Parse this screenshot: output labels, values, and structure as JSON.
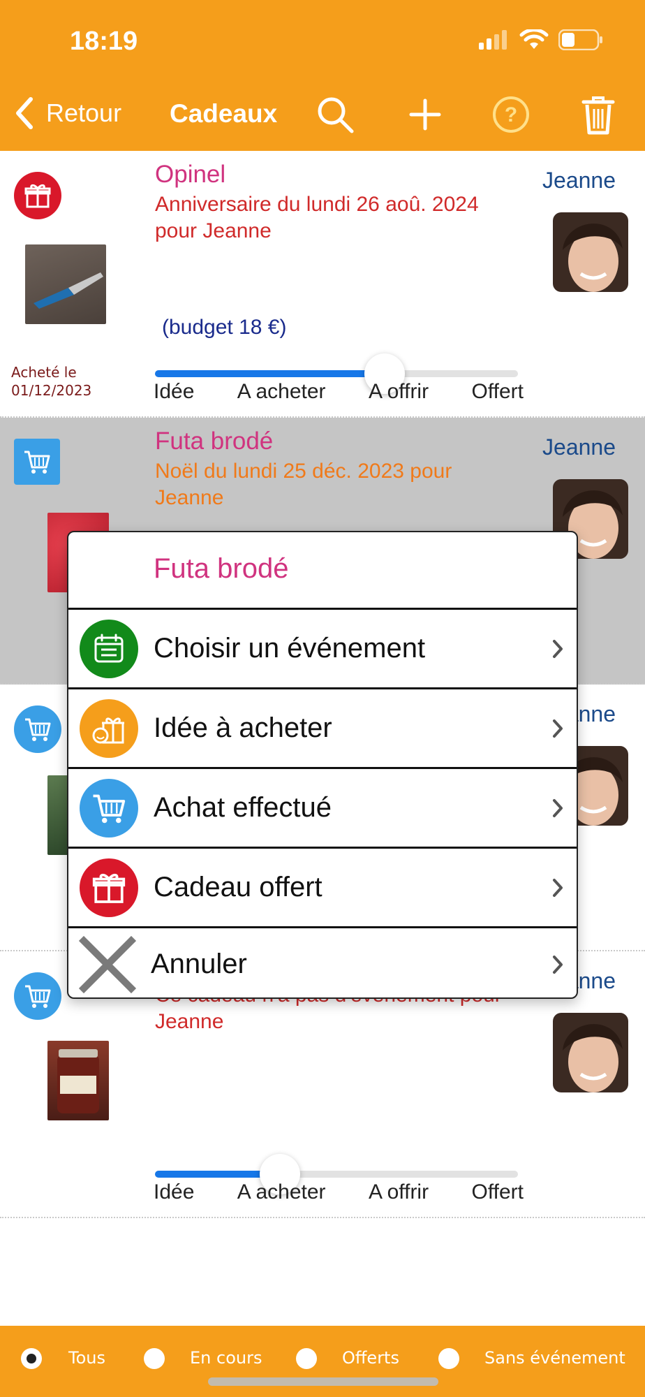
{
  "status_bar": {
    "time": "18:19"
  },
  "nav": {
    "back_label": "Retour",
    "title": "Cadeaux",
    "icons": [
      "search-icon",
      "add-icon",
      "help-icon",
      "trash-icon"
    ]
  },
  "gifts": [
    {
      "title": "Opinel",
      "subtitle": "Anniversaire du lundi 26 aoû. 2024 pour Jeanne",
      "person": "Jeanne",
      "budget": "(budget 18 €)",
      "bought_label": "Acheté le",
      "bought_date": "01/12/2023",
      "status_icon": "gift-icon",
      "progress": 0.65
    },
    {
      "title": "Futa brodé",
      "subtitle": "Noël du lundi 25 déc. 2023 pour Jeanne",
      "person": "Jeanne",
      "status_icon": "cart-icon"
    },
    {
      "person": "Jeanne",
      "status_icon": "cart-icon"
    },
    {
      "subtitle": "Ce cadeau n'a pas d'événement pour Jeanne",
      "person": "Jeanne",
      "status_icon": "cart-icon",
      "progress": 0.35
    }
  ],
  "slider_labels": [
    "Idée",
    "A acheter",
    "A offrir",
    "Offert"
  ],
  "menu": {
    "title": "Futa brodé",
    "items": [
      {
        "label": "Choisir un événement",
        "icon": "calendar-icon",
        "color": "#128a1a"
      },
      {
        "label": "Idée à acheter",
        "icon": "idea-gift-icon",
        "color": "#f59e1b"
      },
      {
        "label": "Achat effectué",
        "icon": "cart-icon",
        "color": "#3a9fe6"
      },
      {
        "label": "Cadeau offert",
        "icon": "gift-icon",
        "color": "#d9182a"
      },
      {
        "label": "Annuler",
        "icon": "close-icon",
        "color": "#777777"
      }
    ]
  },
  "filters": {
    "selected": "Tous",
    "options": [
      "Tous",
      "En cours",
      "Offerts",
      "Sans événement"
    ]
  }
}
